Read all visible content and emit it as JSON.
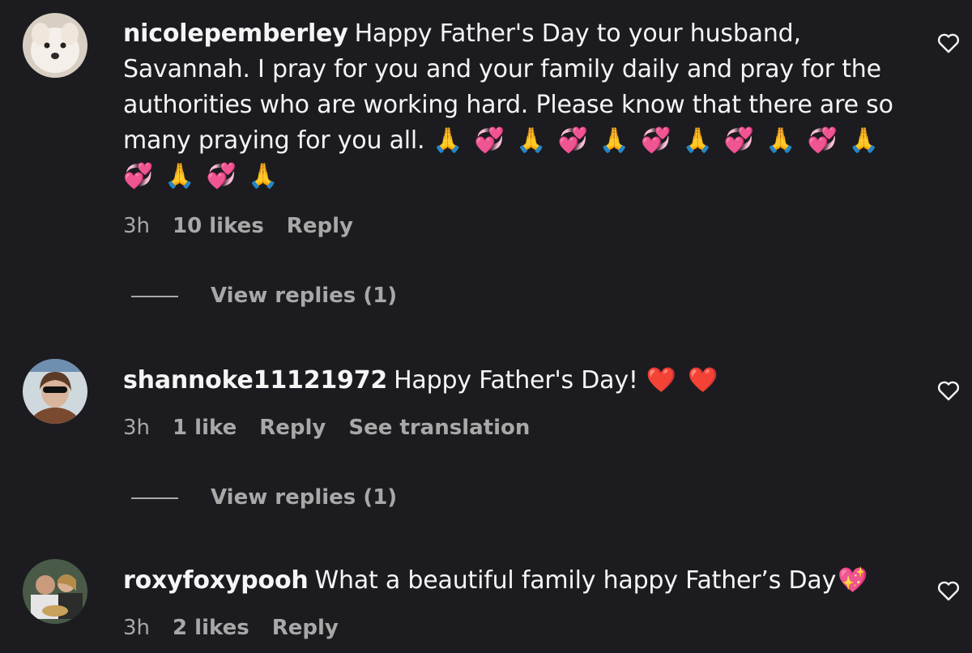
{
  "comments": [
    {
      "username": "nicolepemberley",
      "text": "Happy Father's Day to your husband, Savannah. I pray for you and your family daily and pray for the authorities who are working hard. Please know that there are so many praying for you all.",
      "emojis": "🙏💞🙏💞🙏💞🙏💞🙏💞🙏💞🙏💞🙏",
      "time": "3h",
      "likes": "10 likes",
      "reply": "Reply",
      "view_replies": "View replies (1)"
    },
    {
      "username": "shannoke11121972",
      "text": "Happy Father's Day!",
      "emojis": "❤️❤️",
      "time": "3h",
      "likes": "1 like",
      "reply": "Reply",
      "translate": "See translation",
      "view_replies": "View replies (1)"
    },
    {
      "username": "roxyfoxypooh",
      "text": "What a beautiful family happy Father’s Day",
      "emojis": "💖",
      "time": "3h",
      "likes": "2 likes",
      "reply": "Reply"
    }
  ],
  "colors": {
    "background": "#1c1c20",
    "primary_text": "#f5f5f5",
    "secondary_text": "#a8a8a8"
  },
  "icons": {
    "like": "heart-outline-icon"
  }
}
